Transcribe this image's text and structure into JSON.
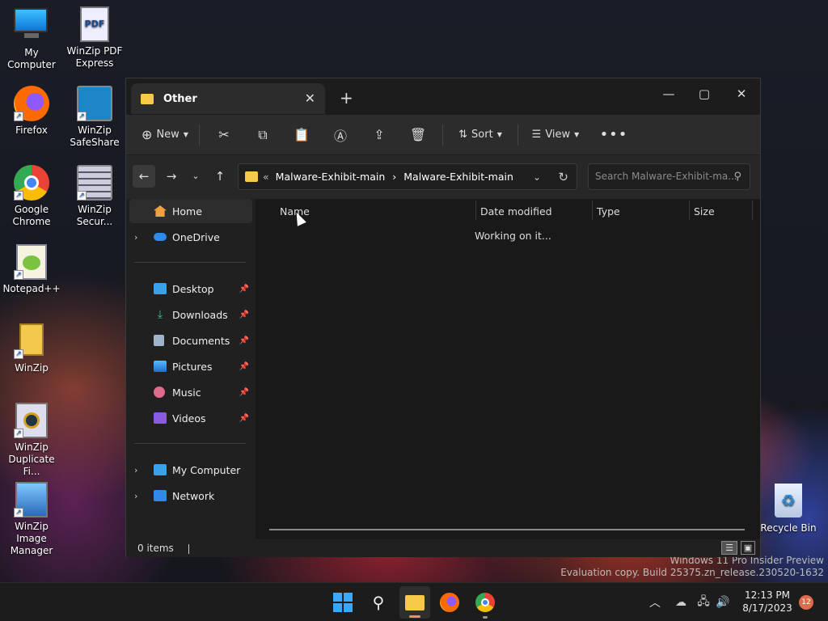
{
  "desktop_icons": [
    {
      "label": "My Computer"
    },
    {
      "label": "WinZip PDF Express"
    },
    {
      "label": "Firefox"
    },
    {
      "label": "WinZip SafeShare"
    },
    {
      "label": "Google Chrome"
    },
    {
      "label": "WinZip Secur..."
    },
    {
      "label": "Notepad++"
    },
    {
      "label": "WinZip"
    },
    {
      "label": "WinZip Duplicate Fi..."
    },
    {
      "label": "WinZip Image Manager"
    },
    {
      "label": "Recycle Bin"
    }
  ],
  "window": {
    "tab_title": "Other",
    "toolbar": {
      "new_label": "New",
      "sort_label": "Sort",
      "view_label": "View"
    },
    "address": {
      "overflow": "«",
      "crumbs": [
        "Malware-Exhibit-main",
        "Malware-Exhibit-main"
      ]
    },
    "search": {
      "placeholder": "Search Malware-Exhibit-ma..."
    },
    "sidebar": {
      "home": "Home",
      "onedrive": "OneDrive",
      "quick": [
        "Desktop",
        "Downloads",
        "Documents",
        "Pictures",
        "Music",
        "Videos"
      ],
      "mycomputer": "My Computer",
      "network": "Network"
    },
    "columns": [
      "Name",
      "Date modified",
      "Type",
      "Size"
    ],
    "loading": "Working on it...",
    "status": "0 items"
  },
  "watermark": {
    "line1": "Windows 11 Pro Insider Preview",
    "line2": "Evaluation copy. Build 25375.zn_release.230520-1632"
  },
  "clock": {
    "time": "12:13 PM",
    "date": "8/17/2023"
  },
  "notification_count": "12"
}
